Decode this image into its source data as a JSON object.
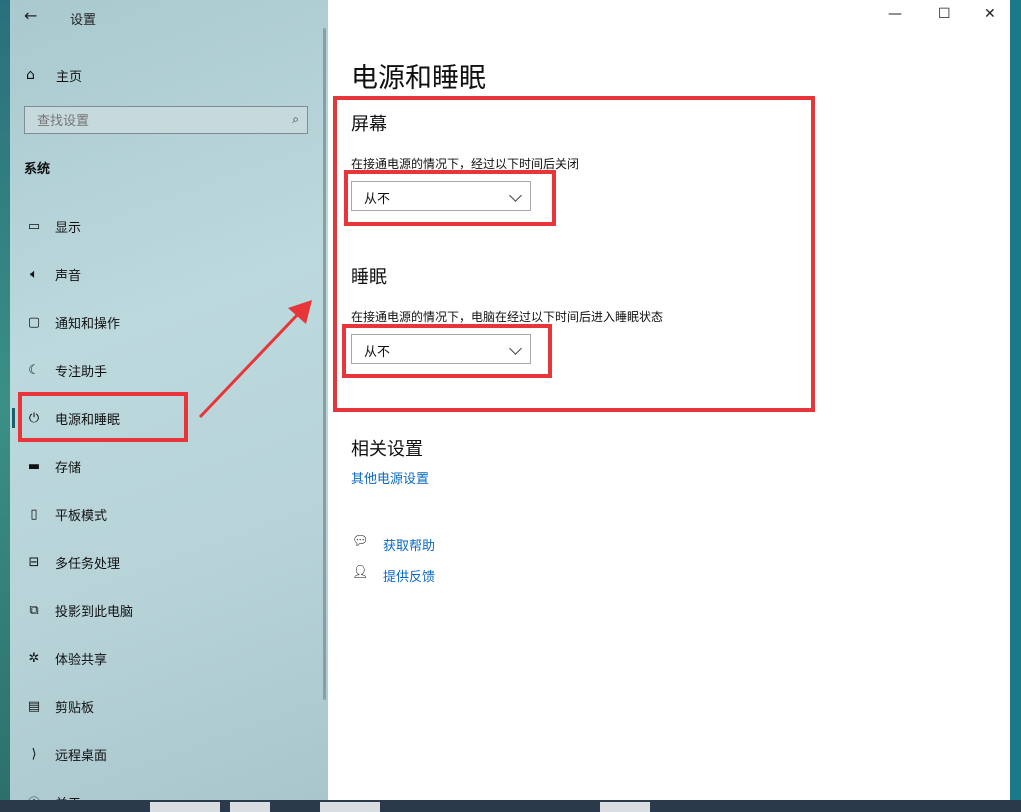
{
  "window": {
    "title": "设置",
    "minimize_label": "—",
    "maximize_label": "☐",
    "close_label": "✕"
  },
  "sidebar": {
    "home_label": "主页",
    "search_placeholder": "查找设置",
    "section_label": "系统",
    "items": [
      {
        "label": "显示",
        "icon": "display-icon"
      },
      {
        "label": "声音",
        "icon": "speaker-icon"
      },
      {
        "label": "通知和操作",
        "icon": "notification-icon"
      },
      {
        "label": "专注助手",
        "icon": "moon-icon"
      },
      {
        "label": "电源和睡眠",
        "icon": "power-icon",
        "selected": true
      },
      {
        "label": "存储",
        "icon": "storage-icon"
      },
      {
        "label": "平板模式",
        "icon": "tablet-icon"
      },
      {
        "label": "多任务处理",
        "icon": "multitask-icon"
      },
      {
        "label": "投影到此电脑",
        "icon": "project-icon"
      },
      {
        "label": "体验共享",
        "icon": "share-icon"
      },
      {
        "label": "剪贴板",
        "icon": "clipboard-icon"
      },
      {
        "label": "远程桌面",
        "icon": "remote-icon"
      },
      {
        "label": "关于",
        "icon": "info-icon"
      }
    ]
  },
  "main": {
    "page_title": "电源和睡眠",
    "screen": {
      "heading": "屏幕",
      "description": "在接通电源的情况下，经过以下时间后关闭",
      "value": "从不"
    },
    "sleep": {
      "heading": "睡眠",
      "description": "在接通电源的情况下，电脑在经过以下时间后进入睡眠状态",
      "value": "从不"
    },
    "related": {
      "heading": "相关设置",
      "link": "其他电源设置"
    },
    "help": {
      "get_help": "获取帮助",
      "feedback": "提供反馈"
    }
  },
  "colors": {
    "highlight": "#e8353a",
    "link": "#0a68c4",
    "sidebar": "#b7d3d8"
  }
}
